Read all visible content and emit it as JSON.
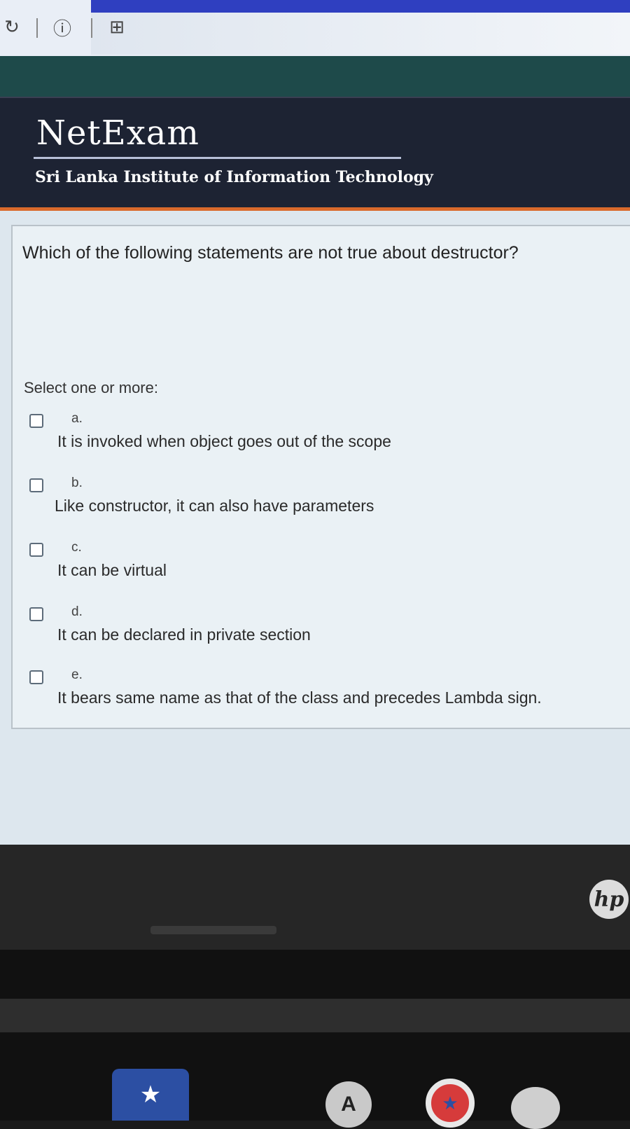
{
  "browser": {
    "icons": [
      "reload-icon",
      "info-icon",
      "bookmark-add-icon"
    ]
  },
  "header": {
    "logo_title": "NetExam",
    "subtitle": "Sri Lanka Institute of Information Technology"
  },
  "question": {
    "text": "Which of the following statements are not true about destructor?",
    "instruction": "Select one or more:",
    "options": [
      {
        "letter": "a.",
        "text": "It is invoked when object goes out of the scope",
        "checked": false
      },
      {
        "letter": "b.",
        "text": "Like constructor, it can also have parameters",
        "checked": false
      },
      {
        "letter": "c.",
        "text": "It can be virtual",
        "checked": false
      },
      {
        "letter": "d.",
        "text": "It can be declared in private section",
        "checked": false
      },
      {
        "letter": "e.",
        "text": "It bears same name as that of the class and precedes Lambda sign.",
        "checked": false
      }
    ]
  },
  "laptop": {
    "brand": "hp"
  },
  "colors": {
    "header_bg": "#1d2333",
    "accent_orange": "#d96a2c",
    "content_bg": "#eaf1f5"
  }
}
